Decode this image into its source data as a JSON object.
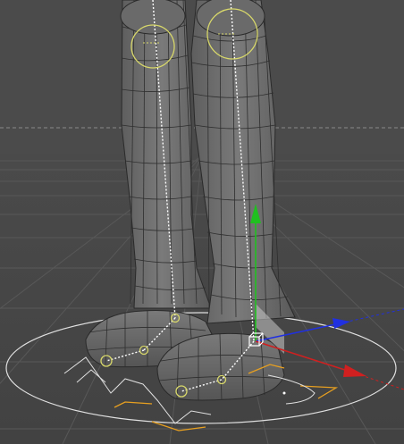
{
  "viewport": {
    "projection": "perspective",
    "shading": "gouraud-lines",
    "background_top": "#4b4b4b",
    "background_floor": "#464646",
    "grid_color": "#5a5a5a",
    "horizon_color": "#8a8a8a"
  },
  "scene": {
    "mesh_fill": "#707070",
    "mesh_wire": "#2a2a2a",
    "joint_color": "#d8d86a",
    "bone_color": "#ffffff",
    "ik_ring_color": "#e8e8e8",
    "ik_target_color": "#e8a020"
  },
  "gizmo": {
    "x_axis_color": "#d02020",
    "y_axis_color": "#20c020",
    "z_axis_color": "#2030e0",
    "plane_handle_color": "#c8c8c8"
  }
}
